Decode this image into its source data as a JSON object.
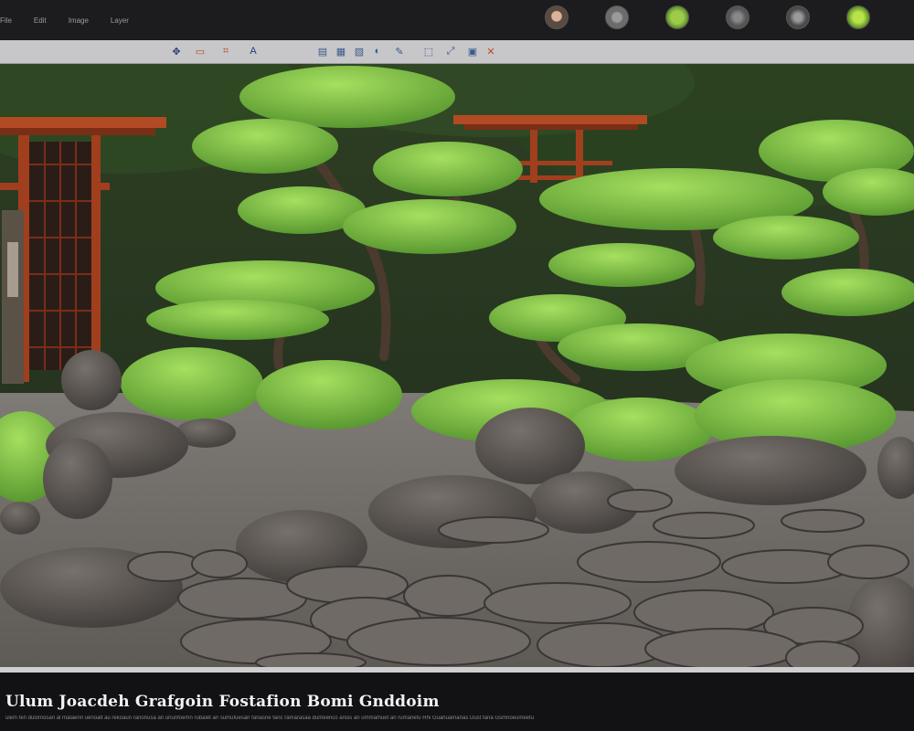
{
  "menu": {
    "items": [
      "File",
      "Edit",
      "Image",
      "Layer"
    ]
  },
  "thumbnails": [
    {
      "icon": "portrait-thumbnail-icon",
      "color": "#5a4a40"
    },
    {
      "icon": "stone-thumbnail-icon",
      "color": "#6c6c6c"
    },
    {
      "icon": "leaf-thumbnail-icon",
      "color": "#7aa83a"
    },
    {
      "icon": "tree-thumbnail-icon",
      "color": "#555555"
    },
    {
      "icon": "bonsai-thumbnail-icon",
      "color": "#4a4a4a"
    },
    {
      "icon": "moss-thumbnail-icon",
      "color": "#8bc23b"
    }
  ],
  "toolbar": {
    "tools": [
      "move-icon",
      "frame-icon",
      "crop-icon",
      "text-icon",
      "layers-icon",
      "grid-icon",
      "brush-icon",
      "adjust-icon",
      "pen-icon",
      "select-icon",
      "transform-icon",
      "erase-icon"
    ]
  },
  "caption": {
    "title": "Ulum Joacdeh Grafgoin Fostafion Bomi Gnddoim",
    "subtitle": "ulem fen dulomosan al malaenn uenoalt au rekoaun ranonusa an ununfoemn rubalet an sumufuesan fanasne fanc ramarasaa dumeenco ansis an ummamuet an rumanetu Rhi Guanuamanas Dust fana Gsmnoeumeetu"
  },
  "colors": {
    "accent_wood": "#b24a24",
    "foliage": "#7cc241",
    "stone": "#5a5552"
  }
}
